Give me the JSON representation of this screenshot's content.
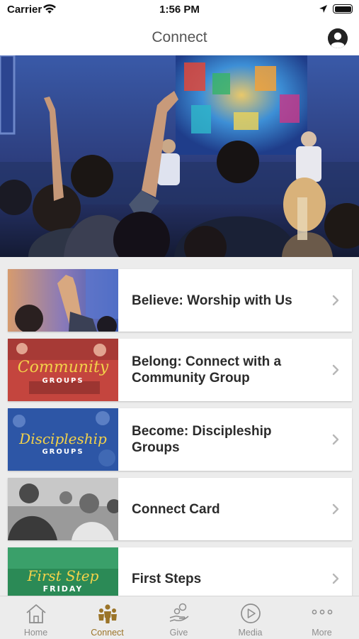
{
  "status_bar": {
    "carrier": "Carrier",
    "time": "1:56 PM"
  },
  "header": {
    "title": "Connect",
    "profile_icon": "user-circle-icon"
  },
  "hero": {
    "description_icon": "worship-hero-photo"
  },
  "list": {
    "items": [
      {
        "label": "Believe: Worship with Us",
        "thumb_icon": "worship-raised-hand-photo"
      },
      {
        "label": "Belong: Connect with a Community Group",
        "thumb_icon": "community-groups-photo",
        "thumb_script": "Community",
        "thumb_caps": "GROUPS"
      },
      {
        "label": "Become: Discipleship Groups",
        "thumb_icon": "discipleship-groups-photo",
        "thumb_script": "Discipleship",
        "thumb_caps": "GROUPS"
      },
      {
        "label": "Connect Card",
        "thumb_icon": "connect-card-photo"
      },
      {
        "label": "First Steps",
        "thumb_icon": "first-step-friday-photo",
        "thumb_script": "First Step",
        "thumb_caps": "FRIDAY"
      }
    ]
  },
  "tab_bar": {
    "active_color": "#9b7428",
    "inactive_color": "#8e8e8e",
    "tabs": [
      {
        "label": "Home",
        "icon": "home-icon"
      },
      {
        "label": "Connect",
        "icon": "people-group-icon",
        "active": true
      },
      {
        "label": "Give",
        "icon": "give-hand-coin-icon"
      },
      {
        "label": "Media",
        "icon": "play-circle-icon"
      },
      {
        "label": "More",
        "icon": "more-dots-icon"
      }
    ]
  }
}
